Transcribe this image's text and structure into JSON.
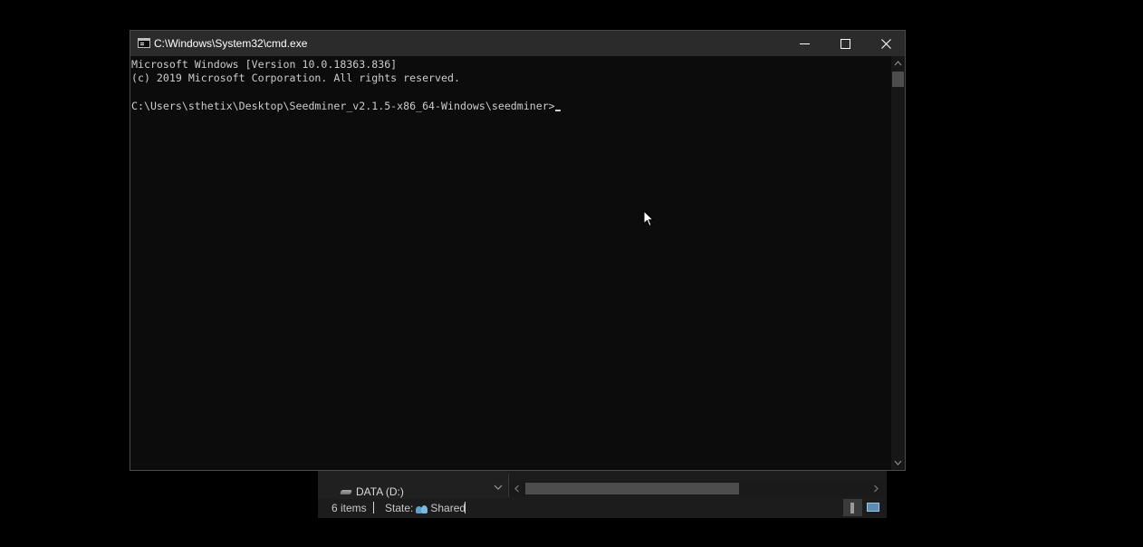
{
  "background_explorer": {
    "nav_pane": {
      "drive_label": "DATA (D:)"
    },
    "statusbar": {
      "items_count": "6 items",
      "state_label": "State:",
      "state_value": "Shared"
    },
    "view_buttons": [
      "details-view",
      "large-icons-view"
    ]
  },
  "cmd_window": {
    "title": "C:\\Windows\\System32\\cmd.exe",
    "controls": {
      "minimize_icon": "minimize-icon",
      "maximize_icon": "maximize-icon",
      "close_icon": "close-icon"
    },
    "console": {
      "lines": [
        "Microsoft Windows [Version 10.0.18363.836]",
        "(c) 2019 Microsoft Corporation. All rights reserved.",
        ""
      ],
      "prompt": "C:\\Users\\sthetix\\Desktop\\Seedminer_v2.1.5-x86_64-Windows\\seedminer>"
    }
  },
  "colors": {
    "desktop_background": "#000000",
    "console_background": "#0c0c0c",
    "console_text": "#cccccc",
    "titlebar": "#2b2b2b",
    "title_text": "#ffffff"
  }
}
